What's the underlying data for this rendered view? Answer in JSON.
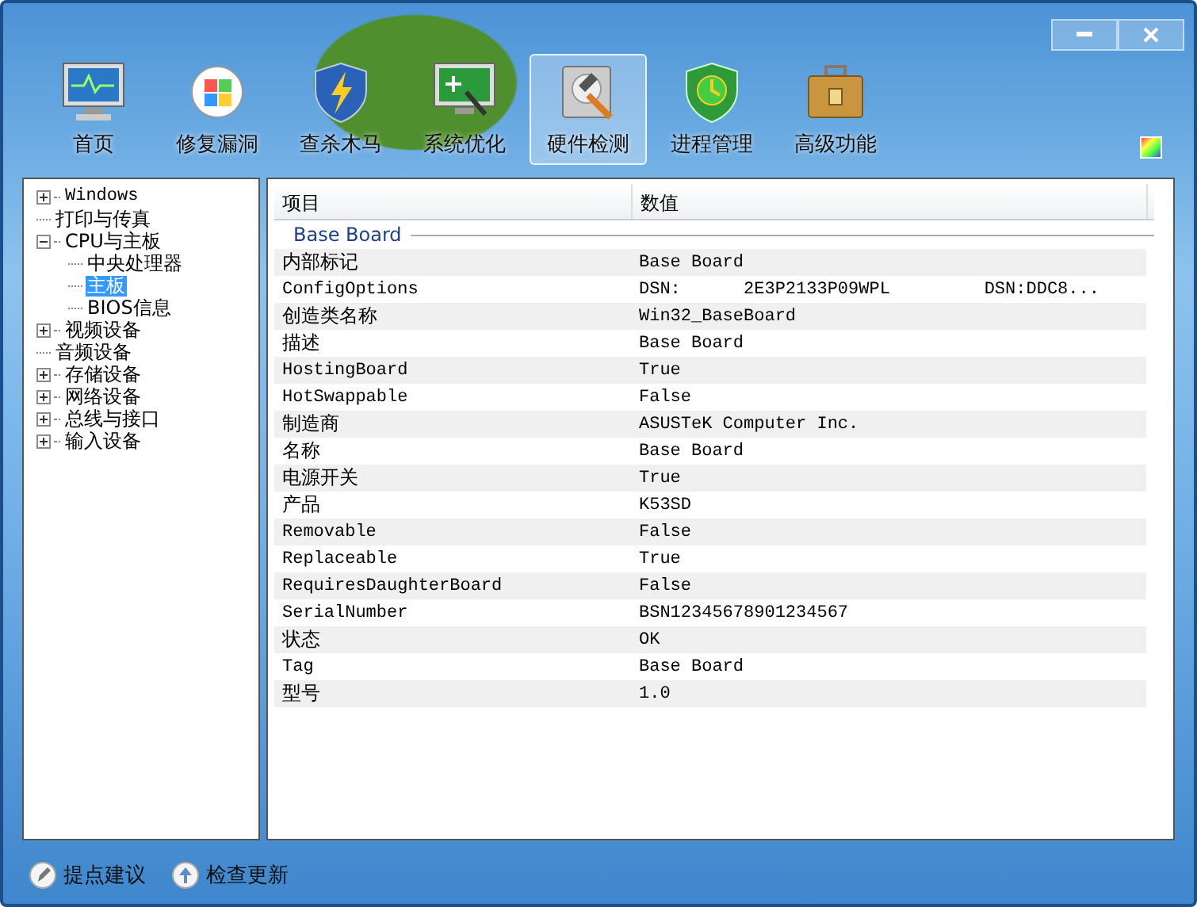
{
  "toolbar": [
    {
      "label": "首页",
      "selected": false
    },
    {
      "label": "修复漏洞",
      "selected": false
    },
    {
      "label": "查杀木马",
      "selected": false
    },
    {
      "label": "系统优化",
      "selected": false
    },
    {
      "label": "硬件检测",
      "selected": true
    },
    {
      "label": "进程管理",
      "selected": false
    },
    {
      "label": "高级功能",
      "selected": false
    }
  ],
  "tree": [
    {
      "label": "Windows",
      "expanded": false,
      "selected": false
    },
    {
      "label": "打印与传真",
      "selected": false
    },
    {
      "label": "CPU与主板",
      "expanded": true,
      "selected": false,
      "children": [
        {
          "label": "中央处理器",
          "selected": false
        },
        {
          "label": "主板",
          "selected": true
        },
        {
          "label": "BIOS信息",
          "selected": false
        }
      ]
    },
    {
      "label": "视频设备",
      "expanded": false,
      "selected": false
    },
    {
      "label": "音频设备",
      "selected": false
    },
    {
      "label": "存储设备",
      "expanded": false,
      "selected": false
    },
    {
      "label": "网络设备",
      "expanded": false,
      "selected": false
    },
    {
      "label": "总线与接口",
      "expanded": false,
      "selected": false
    },
    {
      "label": "输入设备",
      "expanded": false,
      "selected": false
    }
  ],
  "table": {
    "columns": [
      "项目",
      "数值"
    ],
    "group": "Base Board",
    "rows": [
      {
        "item": "内部标记",
        "value": "Base Board"
      },
      {
        "item": "ConfigOptions",
        "value": "DSN:      2E3P2133P09WPL         DSN:DDC8..."
      },
      {
        "item": "创造类名称",
        "value": "Win32_BaseBoard"
      },
      {
        "item": "描述",
        "value": "Base Board"
      },
      {
        "item": "HostingBoard",
        "value": "True"
      },
      {
        "item": "HotSwappable",
        "value": "False"
      },
      {
        "item": "制造商",
        "value": "ASUSTeK Computer Inc."
      },
      {
        "item": "名称",
        "value": "Base Board"
      },
      {
        "item": "电源开关",
        "value": "True"
      },
      {
        "item": "产品",
        "value": "K53SD"
      },
      {
        "item": "Removable",
        "value": "False"
      },
      {
        "item": "Replaceable",
        "value": "True"
      },
      {
        "item": "RequiresDaughterBoard",
        "value": "False"
      },
      {
        "item": "SerialNumber",
        "value": "BSN12345678901234567"
      },
      {
        "item": "状态",
        "value": "OK"
      },
      {
        "item": "Tag",
        "value": "Base Board"
      },
      {
        "item": "型号",
        "value": "1.0"
      }
    ]
  },
  "footer": [
    {
      "label": "提点建议"
    },
    {
      "label": "检查更新"
    }
  ]
}
